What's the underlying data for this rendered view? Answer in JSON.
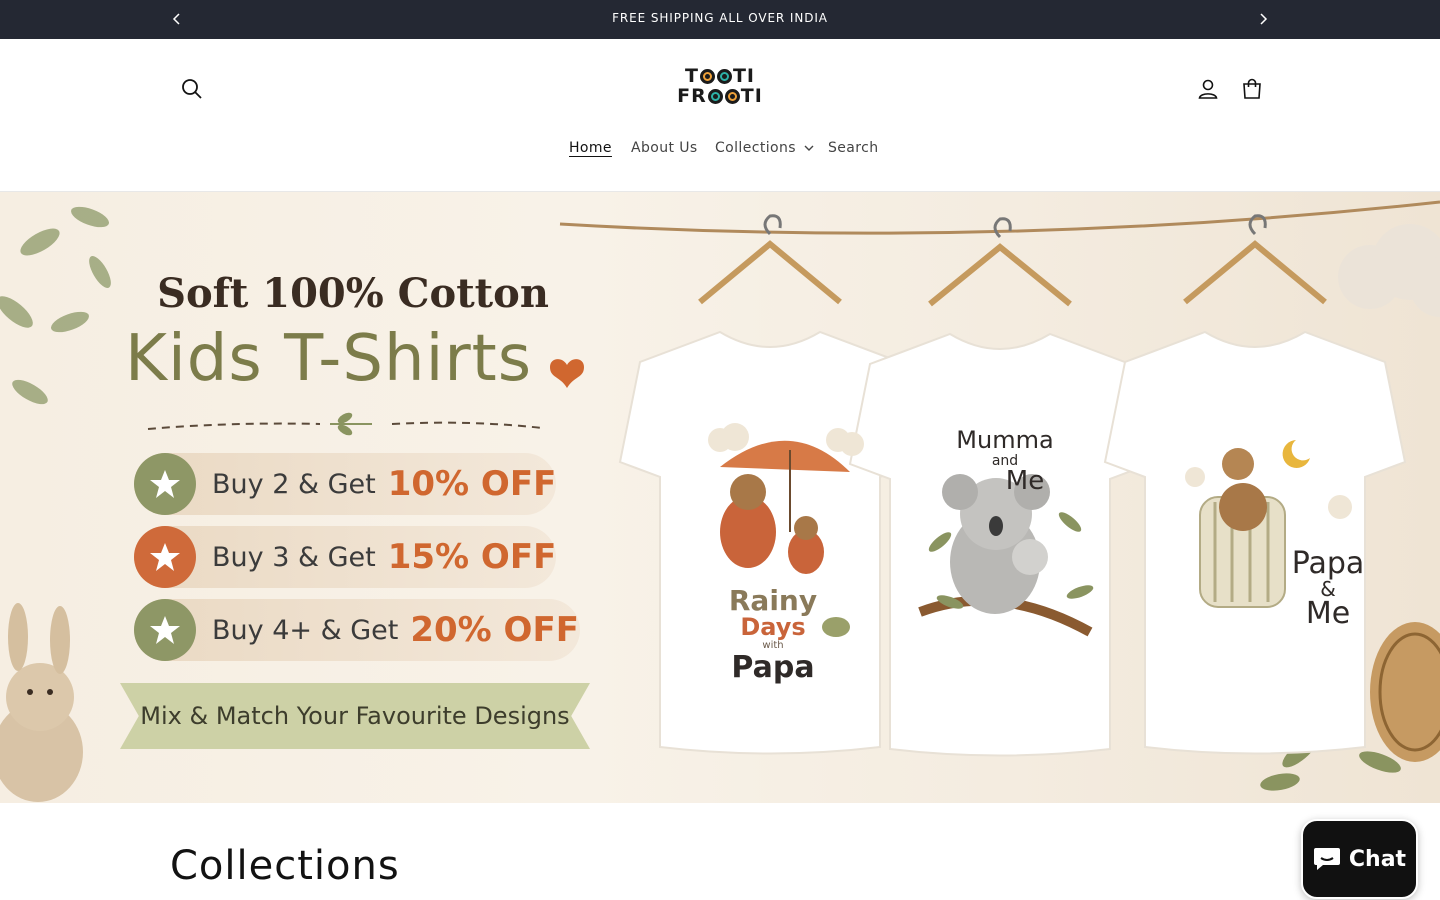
{
  "announcement": {
    "text": "FREE SHIPPING ALL OVER INDIA",
    "prev_icon": "chevron-left-icon",
    "next_icon": "chevron-right-icon"
  },
  "header": {
    "logo": {
      "line1": "TOOTI",
      "line2": "FROOTI"
    },
    "icons": [
      "search-icon",
      "account-icon",
      "cart-icon"
    ],
    "nav": {
      "home": "Home",
      "about": "About Us",
      "collections": "Collections",
      "search": "Search"
    }
  },
  "hero": {
    "headline_top": "Soft 100% Cotton",
    "headline_main": "Kids T-Shirts",
    "offers": [
      {
        "label": "Buy 2 & Get",
        "discount": "10% OFF",
        "color": "#8e9766"
      },
      {
        "label": "Buy 3 & Get",
        "discount": "15% OFF",
        "color": "#cf6a3a"
      },
      {
        "label": "Buy 4+ & Get",
        "discount": "20% OFF",
        "color": "#8e9766"
      }
    ],
    "ribbon": "Mix & Match Your Favourite Designs",
    "shirt_texts": [
      [
        "Rainy",
        "Days",
        "with",
        "Papa"
      ],
      [
        "Mumma",
        "and",
        "Me"
      ],
      [
        "Papa",
        "&",
        "Me"
      ]
    ]
  },
  "collections_section": {
    "title": "Collections"
  },
  "chat": {
    "label": "Chat",
    "icon": "chat-bubble-icon"
  },
  "colors": {
    "announcement_bg": "#242833",
    "accent_orange": "#d0672f",
    "accent_olive": "#8e9766"
  }
}
